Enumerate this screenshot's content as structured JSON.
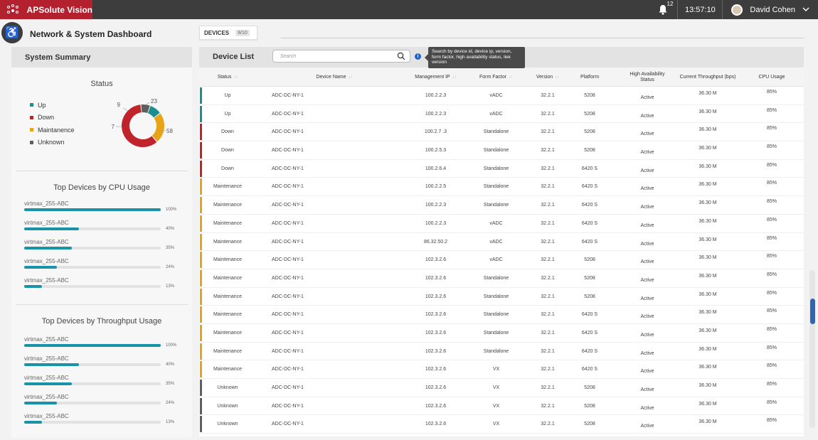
{
  "app": {
    "title": "APSolute Vision"
  },
  "topbar": {
    "notifications_count": "12",
    "time": "13:57:10",
    "user_name": "David Cohen"
  },
  "page": {
    "title": "Network & System Dashboard"
  },
  "summary": {
    "header": "System Summary",
    "status_title": "Status",
    "legend": [
      {
        "label": "Up",
        "color": "#1b8f8f"
      },
      {
        "label": "Down",
        "color": "#c1232b"
      },
      {
        "label": "Maintanence",
        "color": "#e8a317"
      },
      {
        "label": "Unknown",
        "color": "#5f5f5f"
      }
    ],
    "donut": [
      {
        "status": "Up",
        "value": 9,
        "color": "#1b8f8f"
      },
      {
        "status": "Maintanence",
        "value": 23,
        "color": "#e8a317"
      },
      {
        "status": "Down",
        "value": 58,
        "color": "#c1232b"
      },
      {
        "status": "Unknown",
        "value": 7,
        "color": "#5f5f5f"
      }
    ],
    "cpu_title": "Top Devices by CPU Usage",
    "cpu_bars": [
      {
        "name": "virtmax_255-ABC",
        "pct": 100,
        "label": "100%"
      },
      {
        "name": "virtmax_255-ABC",
        "pct": 40,
        "label": "40%"
      },
      {
        "name": "virtmax_255-ABC",
        "pct": 35,
        "label": "35%"
      },
      {
        "name": "virtmax_255-ABC",
        "pct": 24,
        "label": "24%"
      },
      {
        "name": "virtmax_255-ABC",
        "pct": 13,
        "label": "13%"
      }
    ],
    "throughput_title": "Top Devices by Throughput Usage",
    "throughput_bars": [
      {
        "name": "virtmax_255-ABC",
        "pct": 100,
        "label": "100%"
      },
      {
        "name": "virtmax_255-ABC",
        "pct": 40,
        "label": "40%"
      },
      {
        "name": "virtmax_255-ABC",
        "pct": 35,
        "label": "35%"
      },
      {
        "name": "virtmax_255-ABC",
        "pct": 24,
        "label": "24%"
      },
      {
        "name": "virtmax_255-ABC",
        "pct": 13,
        "label": "13%"
      }
    ]
  },
  "devices_tab": {
    "label": "DEVICES",
    "count": "8/10"
  },
  "device_list": {
    "title": "Device List",
    "search_placeholder": "Search",
    "tooltip": "Search by device id, device ip, version, form factor, high availability status, liek version",
    "columns": {
      "status": "Status",
      "name": "Device Name",
      "ip": "Management IP",
      "form": "Form Factor",
      "version": "Version",
      "platform": "Platform",
      "ha": "High Availability Status",
      "throughput": "Current Throughput (bps)",
      "cpu": "CPU Usage"
    },
    "sort_glyph": "↓↑",
    "status_colors": {
      "Up": "#1b8f8f",
      "Down": "#c1232b",
      "Maintenance": "#e8a317",
      "Unknown": "#5f5f5f"
    },
    "rows": [
      {
        "status": "Up",
        "name": "ADC-DC-NY-1",
        "ip": "100.2.2.3",
        "form": "vADC",
        "version": "32.2.1",
        "platform": "5208",
        "ha": "Active",
        "throughput": "36.30 M",
        "cpu": "85%"
      },
      {
        "status": "Up",
        "name": "ADC-DC-NY-1",
        "ip": "100.2.2.3",
        "form": "vADC",
        "version": "32.2.1",
        "platform": "5208",
        "ha": "Active",
        "throughput": "36.30 M",
        "cpu": "85%"
      },
      {
        "status": "Down",
        "name": "ADC-DC-NY-1",
        "ip": "100.2.7  .3",
        "form": "Standalone",
        "version": "32.2.1",
        "platform": "5208",
        "ha": "Active",
        "throughput": "36.30 M",
        "cpu": "85%"
      },
      {
        "status": "Down",
        "name": "ADC-DC-NY-1",
        "ip": "100.2.5.3",
        "form": "Standalone",
        "version": "32.2.1",
        "platform": "5208",
        "ha": "Active",
        "throughput": "36.30 M",
        "cpu": "85%"
      },
      {
        "status": "Down",
        "name": "ADC-DC-NY-1",
        "ip": "100.2.6.4",
        "form": "Standalone",
        "version": "32.2.1",
        "platform": "6420 S",
        "ha": "Active",
        "throughput": "36.30 M",
        "cpu": "85%"
      },
      {
        "status": "Maintenance",
        "name": "ADC-DC-NY-1",
        "ip": "100.2.2.5",
        "form": "Standalone",
        "version": "32.2.1",
        "platform": "6420 S",
        "ha": "Active",
        "throughput": "36.30 M",
        "cpu": "85%"
      },
      {
        "status": "Maintenance",
        "name": "ADC-DC-NY-1",
        "ip": "100.2.2.3",
        "form": "Standalone",
        "version": "32.2.1",
        "platform": "6420 S",
        "ha": "Active",
        "throughput": "36.30 M",
        "cpu": "85%"
      },
      {
        "status": "Maintenance",
        "name": "ADC-DC-NY-1",
        "ip": "100.2.2.3",
        "form": "vADC",
        "version": "32.2.1",
        "platform": "6420 S",
        "ha": "Active",
        "throughput": "36.30 M",
        "cpu": "85%"
      },
      {
        "status": "Maintenance",
        "name": "ADC-DC-NY-1",
        "ip": "86.32.50.2",
        "form": "vADC",
        "version": "32.2.1",
        "platform": "6420 S",
        "ha": "Active",
        "throughput": "36.30 M",
        "cpu": "85%"
      },
      {
        "status": "Maintenance",
        "name": "ADC-DC-NY-1",
        "ip": "102.3.2.6",
        "form": "vADC",
        "version": "32.2.1",
        "platform": "5208",
        "ha": "Active",
        "throughput": "36.30 M",
        "cpu": "85%"
      },
      {
        "status": "Maintenance",
        "name": "ADC-DC-NY-1",
        "ip": "102.3.2.6",
        "form": "Standalone",
        "version": "32.2.1",
        "platform": "5208",
        "ha": "Active",
        "throughput": "36.30 M",
        "cpu": "85%"
      },
      {
        "status": "Maintenance",
        "name": "ADC-DC-NY-1",
        "ip": "102.3.2.6",
        "form": "Standalone",
        "version": "32.2.1",
        "platform": "5208",
        "ha": "Active",
        "throughput": "36.30 M",
        "cpu": "85%"
      },
      {
        "status": "Maintenance",
        "name": "ADC-DC-NY-1",
        "ip": "102.3.2.6",
        "form": "Standalone",
        "version": "32.2.1",
        "platform": "6420 S",
        "ha": "Active",
        "throughput": "36.30 M",
        "cpu": "85%"
      },
      {
        "status": "Maintenance",
        "name": "ADC-DC-NY-1",
        "ip": "102.3.2.6",
        "form": "Standalone",
        "version": "32.2.1",
        "platform": "6420 S",
        "ha": "Active",
        "throughput": "36.30 M",
        "cpu": "85%"
      },
      {
        "status": "Maintenance",
        "name": "ADC-DC-NY-1",
        "ip": "102.3.2.6",
        "form": "Standalone",
        "version": "32.2.1",
        "platform": "6420 S",
        "ha": "Active",
        "throughput": "36.30 M",
        "cpu": "85%"
      },
      {
        "status": "Maintenance",
        "name": "ADC-DC-NY-1",
        "ip": "102.3.2.6",
        "form": "VX",
        "version": "32.2.1",
        "platform": "6420 S",
        "ha": "Active",
        "throughput": "36.30 M",
        "cpu": "85%"
      },
      {
        "status": "Unknown",
        "name": "ADC-DC-NY-1",
        "ip": "102.3.2.6",
        "form": "VX",
        "version": "32.2.1",
        "platform": "5208",
        "ha": "Active",
        "throughput": "36.30 M",
        "cpu": "85%"
      },
      {
        "status": "Unknown",
        "name": "ADC-DC-NY-1",
        "ip": "102.3.2.6",
        "form": "VX",
        "version": "32.2.1",
        "platform": "5208",
        "ha": "Active",
        "throughput": "36.30 M",
        "cpu": "85%"
      },
      {
        "status": "Unknown",
        "name": "ADC-DC-NY-1",
        "ip": "102.3.2.6",
        "form": "VX",
        "version": "32.2.1",
        "platform": "5208",
        "ha": "Active",
        "throughput": "36.30 M",
        "cpu": "85%"
      }
    ]
  }
}
